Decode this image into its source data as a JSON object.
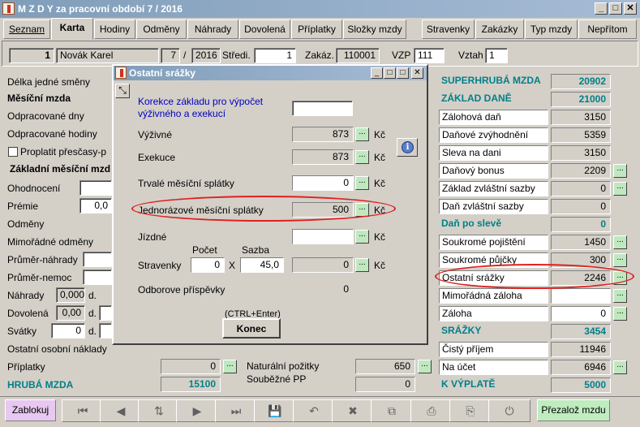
{
  "window": {
    "title": "M Z D Y  za pracovní období  7 / 2016",
    "min": "_",
    "max": "□",
    "close": "✕"
  },
  "tabs": [
    "Seznam",
    "Karta",
    "Hodiny",
    "Odměny",
    "Náhrady",
    "Dovolená",
    "Příplatky",
    "Složky mzdy",
    "Stravenky",
    "Zakázky",
    "Typ mzdy",
    "Nepřítom"
  ],
  "header": {
    "id": "1",
    "name": "Novák Karel",
    "month": "7",
    "sep": "/",
    "year": "2016",
    "stredisko_label": "Středi.",
    "stredisko": "1",
    "zakazka_label": "Zakáz.",
    "zakazka": "110001",
    "vzp_label": "VZP",
    "vzp": "111",
    "vztah_label": "Vztah",
    "vztah": "1"
  },
  "left": {
    "delka": "Délka jedné směny",
    "mesicni_mzda": "Měsíční mzda",
    "odprac_dny": "Odpracované dny",
    "odprac_hod": "Odpracované hodiny",
    "proplatit": "Proplatit přesčasy-p",
    "zakladni": "Základní měsíční mzd",
    "ohodnoceni": "Ohodnocení",
    "premie": "Prémie",
    "premie_val": "0,0",
    "odmeny": "Odměny",
    "mimoradne": "Mimořádné odměny",
    "prumer_nahrady": "Průměr-náhrady",
    "prumer_nemoc": "Průměr-nemoc",
    "nahrady": "Náhrady",
    "nahrady_val": "0,000",
    "nahrady_unit": "d.",
    "dovolena": "Dovolená",
    "dovolena_val": "0,00",
    "dovolena_unit": "d.",
    "svatky": "Svátky",
    "svatky_val": "0",
    "svatky_unit": "d.",
    "ostatni": "Ostatní osobní náklady",
    "priplatky": "Příplatky",
    "priplatky_val": "0",
    "hruba": "HRUBÁ MZDA",
    "hruba_val": "15100",
    "naturalni": "Naturální požitky",
    "naturalni_val": "650",
    "soubezne": "Souběžné PP",
    "soubezne_val": "0"
  },
  "right": [
    {
      "label": "SUPERHRUBÁ MZDA",
      "value": "20902",
      "style": "teal"
    },
    {
      "label": "ZÁKLAD DANĚ",
      "value": "21000",
      "style": "teal"
    },
    {
      "label": "Zálohová daň",
      "value": "3150"
    },
    {
      "label": "Daňové zvýhodnění",
      "value": "5359"
    },
    {
      "label": "Sleva na dani",
      "value": "3150"
    },
    {
      "label": "Daňový bonus",
      "value": "2209",
      "btn": true
    },
    {
      "label": "Základ zvláštní sazby",
      "value": "0",
      "btn": true
    },
    {
      "label": "Daň zvláštní sazby",
      "value": "0"
    },
    {
      "label": "Daň po slevě",
      "value": "0",
      "style": "teal"
    },
    {
      "label": "Soukromé pojištění",
      "value": "1450",
      "btn": true
    },
    {
      "label": "Soukromé půjčky",
      "value": "300",
      "btn": true
    },
    {
      "label": "Ostatní srážky",
      "value": "2246",
      "btn": true
    },
    {
      "label": "Mimořádná záloha",
      "value": "",
      "btn": true
    },
    {
      "label": "Záloha",
      "value": "0",
      "btn": true
    },
    {
      "label": "SRÁŽKY",
      "value": "3454",
      "style": "teal"
    },
    {
      "label": "Čistý příjem",
      "value": "11946"
    },
    {
      "label": "Na účet",
      "value": "6946",
      "btn": true
    },
    {
      "label": "K VÝPLATĚ",
      "value": "5000",
      "style": "teal"
    }
  ],
  "dialog": {
    "title": "Ostatní srážky",
    "korekce": "Korekce základu pro výpočet výživného a exekucí",
    "vyzivne": "Výživné",
    "vyzivne_val": "873",
    "exekuce": "Exekuce",
    "exekuce_val": "873",
    "trvale": "Trvalé měsíční splátky",
    "trvale_val": "0",
    "jednorazove": "Jednorázové měsíční splátky",
    "jednorazove_val": "500",
    "jizdne": "Jízdné",
    "pocet": "Počet",
    "sazba": "Sazba",
    "stravenky": "Stravenky",
    "stravenky_pocet": "0",
    "x": "X",
    "stravenky_sazba": "45,0",
    "stravenky_val": "0",
    "odborove": "Odborove příspěvky",
    "odborove_val": "0",
    "kc": "Kč",
    "ellipsis": "...",
    "shortcut": "(CTRL+Enter)",
    "konec": "Konec"
  },
  "toolbar": {
    "zablokuj": "Zablokuj",
    "prezaloz": "Přezalož mzdu"
  },
  "colors": {
    "teal": "#00808a",
    "highlight": "#e02020",
    "button_green": "#c0e8c0"
  }
}
